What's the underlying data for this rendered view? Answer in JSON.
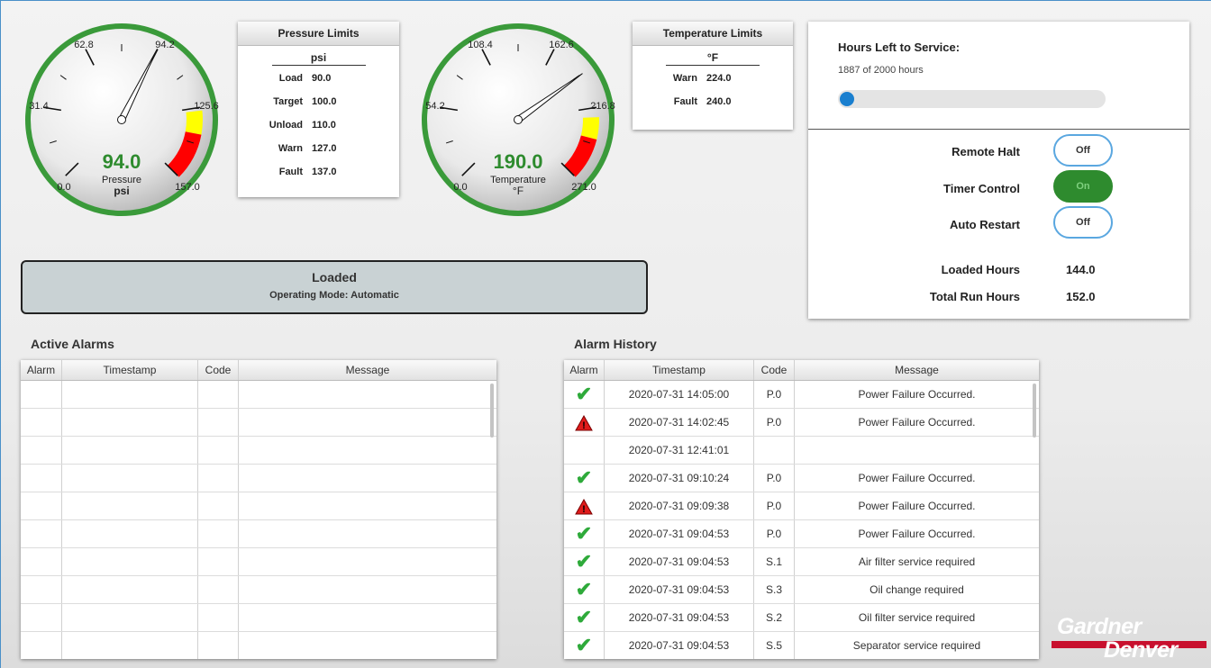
{
  "pressure_gauge": {
    "value": "94.0",
    "label": "Pressure",
    "unit": "psi",
    "ticks": [
      "0.0",
      "31.4",
      "62.8",
      "94.2",
      "125.6",
      "157.0"
    ],
    "reading": 94.0,
    "min": 0,
    "max": 157.0,
    "warn_start": 127.0,
    "fault_start": 137.0
  },
  "pressure_limits": {
    "title": "Pressure Limits",
    "unit": "psi",
    "rows": [
      {
        "label": "Load",
        "value": "90.0"
      },
      {
        "label": "Target",
        "value": "100.0"
      },
      {
        "label": "Unload",
        "value": "110.0"
      },
      {
        "label": "Warn",
        "value": "127.0"
      },
      {
        "label": "Fault",
        "value": "137.0"
      }
    ]
  },
  "temperature_gauge": {
    "value": "190.0",
    "label": "Temperature",
    "unit": "°F",
    "ticks": [
      "0.0",
      "54.2",
      "108.4",
      "162.6",
      "216.8",
      "271.0"
    ],
    "reading": 190.0,
    "min": 0,
    "max": 271.0,
    "warn_start": 224.0,
    "fault_start": 240.0
  },
  "temperature_limits": {
    "title": "Temperature Limits",
    "unit": "°F",
    "rows": [
      {
        "label": "Warn",
        "value": "224.0"
      },
      {
        "label": "Fault",
        "value": "240.0"
      }
    ]
  },
  "status": {
    "state": "Loaded",
    "mode": "Operating Mode: Automatic"
  },
  "service": {
    "title": "Hours Left to Service:",
    "subtitle": "1887 of 2000 hours",
    "progress": 0.0
  },
  "controls": {
    "remote_halt": {
      "label": "Remote Halt",
      "state": "Off"
    },
    "timer_control": {
      "label": "Timer Control",
      "state": "On"
    },
    "auto_restart": {
      "label": "Auto Restart",
      "state": "Off"
    }
  },
  "hours": {
    "loaded_label": "Loaded Hours",
    "loaded_value": "144.0",
    "total_label": "Total Run Hours",
    "total_value": "152.0"
  },
  "active_alarms": {
    "title": "Active Alarms",
    "columns": [
      "Alarm",
      "Timestamp",
      "Code",
      "Message"
    ],
    "rows": []
  },
  "alarm_history": {
    "title": "Alarm History",
    "columns": [
      "Alarm",
      "Timestamp",
      "Code",
      "Message"
    ],
    "rows": [
      {
        "icon": "check-icon",
        "timestamp": "2020-07-31 14:05:00",
        "code": "P.0",
        "message": "Power Failure Occurred."
      },
      {
        "icon": "warning-icon",
        "timestamp": "2020-07-31 14:02:45",
        "code": "P.0",
        "message": "Power Failure Occurred."
      },
      {
        "icon": "",
        "timestamp": "2020-07-31 12:41:01",
        "code": "",
        "message": ""
      },
      {
        "icon": "check-icon",
        "timestamp": "2020-07-31 09:10:24",
        "code": "P.0",
        "message": "Power Failure Occurred."
      },
      {
        "icon": "warning-icon",
        "timestamp": "2020-07-31 09:09:38",
        "code": "P.0",
        "message": "Power Failure Occurred."
      },
      {
        "icon": "check-icon",
        "timestamp": "2020-07-31 09:04:53",
        "code": "P.0",
        "message": "Power Failure Occurred."
      },
      {
        "icon": "check-icon",
        "timestamp": "2020-07-31 09:04:53",
        "code": "S.1",
        "message": "Air filter service required"
      },
      {
        "icon": "check-icon",
        "timestamp": "2020-07-31 09:04:53",
        "code": "S.3",
        "message": "Oil change required"
      },
      {
        "icon": "check-icon",
        "timestamp": "2020-07-31 09:04:53",
        "code": "S.2",
        "message": "Oil filter service required"
      },
      {
        "icon": "check-icon",
        "timestamp": "2020-07-31 09:04:53",
        "code": "S.5",
        "message": "Separator service required"
      }
    ]
  },
  "logo": {
    "line1": "Gardner",
    "line2": "Denver"
  },
  "colors": {
    "ok_green": "#2e8b2e",
    "warn_yellow": "#ffff00",
    "fault_red": "#ff0000",
    "accent_blue": "#1a7fcf"
  }
}
